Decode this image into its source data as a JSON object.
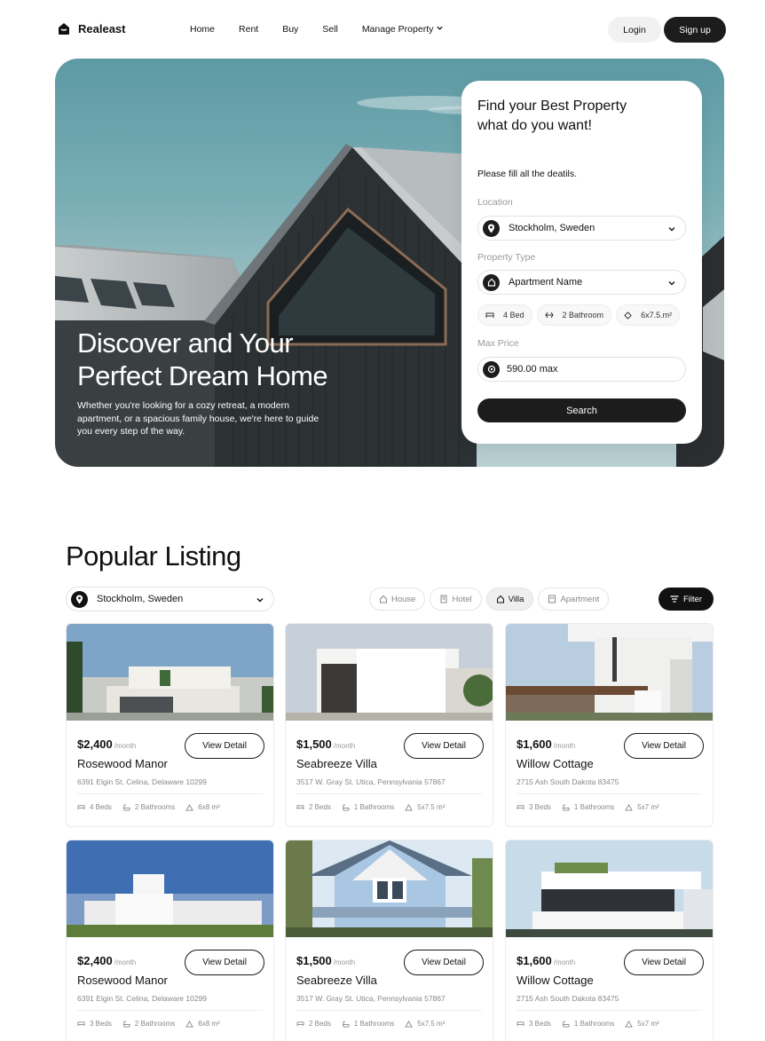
{
  "brand": {
    "name": "Realeast"
  },
  "nav": {
    "links": [
      "Home",
      "Rent",
      "Buy",
      "Sell"
    ],
    "manage": "Manage Property",
    "login": "Login",
    "signup": "Sign up"
  },
  "hero": {
    "title_line1": "Discover and Your",
    "title_line2": "Perfect Dream Home",
    "subtitle": "Whether you're looking for a cozy retreat, a modern apartment, or a spacious family house, we're here to guide you every step of the way."
  },
  "search": {
    "title_line1": "Find your Best Property",
    "title_line2": "what do you want!",
    "note": "Please fill all the deatils.",
    "location_label": "Location",
    "location_value": "Stockholm, Sweden",
    "type_label": "Property Type",
    "type_value": "Apartment Name",
    "chips": [
      "4 Bed",
      "2 Bathroom",
      "6x7.5.m²"
    ],
    "price_label": "Max Price",
    "price_value": "590.00 max",
    "button": "Search"
  },
  "popular": {
    "title": "Popular Listing",
    "location": "Stockholm, Sweden",
    "filters": [
      "House",
      "Hotel",
      "Villa",
      "Apartment"
    ],
    "active_filter": "Villa",
    "filter_button": "Filter",
    "listings": [
      {
        "price": "$2,400",
        "per": "/month",
        "name": "Rosewood Manor",
        "address": "6391 Elgin St. Celina, Delaware 10299",
        "beds": "4 Beds",
        "baths": "2 Bathrooms",
        "size": "6x8 m²",
        "view": "View Detail"
      },
      {
        "price": "$1,500",
        "per": "/month",
        "name": "Seabreeze Villa",
        "address": "3517 W. Gray St. Utica, Pennsylvania 57867",
        "beds": "2 Beds",
        "baths": "1 Bathrooms",
        "size": "5x7.5 m²",
        "view": "View Detail"
      },
      {
        "price": "$1,600",
        "per": "/month",
        "name": "Willow Cottage",
        "address": "2715 Ash South Dakota 83475",
        "beds": "3 Beds",
        "baths": "1 Bathrooms",
        "size": "5x7 m²",
        "view": "View Detail"
      },
      {
        "price": "$2,400",
        "per": "/month",
        "name": "Rosewood Manor",
        "address": "6391 Elgin St. Celina, Delaware 10299",
        "beds": "3 Beds",
        "baths": "2 Bathrooms",
        "size": "6x8 m²",
        "view": "View Detail"
      },
      {
        "price": "$1,500",
        "per": "/month",
        "name": "Seabreeze Villa",
        "address": "3517 W. Gray St. Utica, Pennsylvania 57867",
        "beds": "2 Beds",
        "baths": "1 Bathrooms",
        "size": "5x7.5 m²",
        "view": "View Detail"
      },
      {
        "price": "$1,600",
        "per": "/month",
        "name": "Willow Cottage",
        "address": "2715 Ash South Dakota 83475",
        "beds": "3 Beds",
        "baths": "1 Bathrooms",
        "size": "5x7 m²",
        "view": "View Detail"
      }
    ]
  }
}
